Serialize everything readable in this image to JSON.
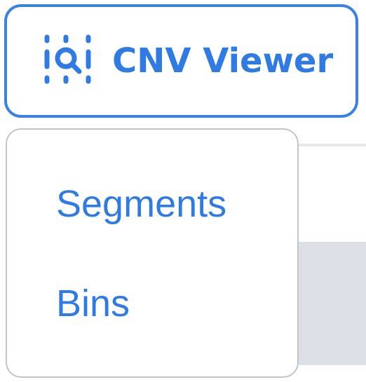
{
  "app": {
    "title": "CNV Viewer",
    "icon": "cnv-chart-search-icon",
    "accent_color": "#2f7be3"
  },
  "menu": {
    "items": [
      {
        "label": "Segments"
      },
      {
        "label": "Bins"
      }
    ]
  }
}
